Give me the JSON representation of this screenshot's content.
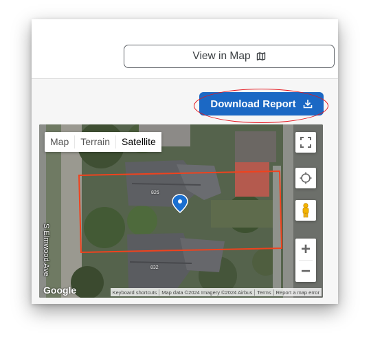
{
  "header": {
    "view_in_map_label": "View in Map",
    "view_in_map_icon": "map-icon"
  },
  "actions": {
    "download_report_label": "Download Report",
    "download_icon": "download-icon",
    "download_color": "#1b68c4"
  },
  "map": {
    "type_options": [
      "Map",
      "Terrain",
      "Satellite"
    ],
    "selected_type": "Satellite",
    "street_label": "S Elmwood Ave",
    "house_numbers": [
      "826",
      "832"
    ],
    "zoom_in_label": "+",
    "zoom_out_label": "−",
    "google_logo": "Google",
    "attribution": {
      "keyboard": "Keyboard shortcuts",
      "data": "Map data ©2024 Imagery ©2024 Airbus",
      "terms": "Terms",
      "report": "Report a map error"
    },
    "property_outline_color": "#f0421d",
    "pin_color": "#1b6fd0"
  },
  "annotation_color": "#e4141b"
}
